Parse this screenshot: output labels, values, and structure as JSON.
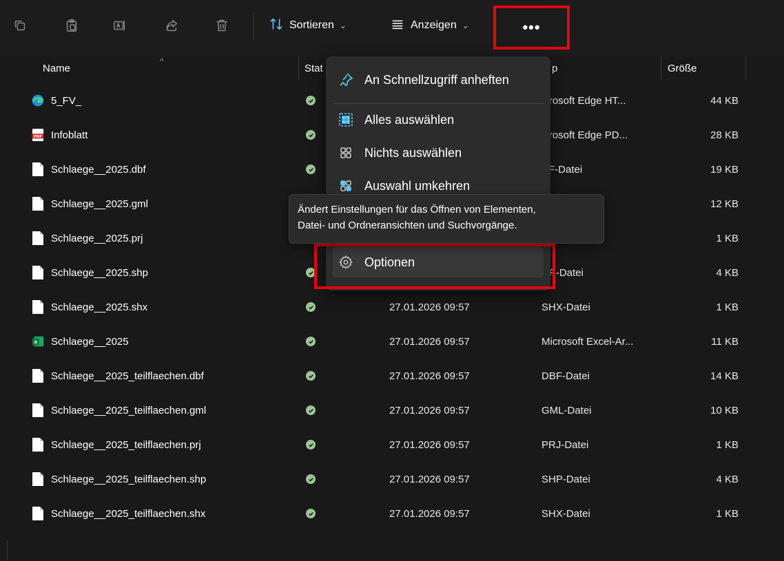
{
  "toolbar": {
    "icons": [
      "copy-icon",
      "paste-icon",
      "rename-icon",
      "share-icon",
      "delete-icon"
    ],
    "sort_label": "Sortieren",
    "view_label": "Anzeigen",
    "more_label": "•••"
  },
  "columns": {
    "name": "Name",
    "status": "Stat",
    "type": "p",
    "size": "Größe"
  },
  "menu": {
    "pin_label": "An Schnellzugriff anheften",
    "select_all_label": "Alles auswählen",
    "select_none_label": "Nichts auswählen",
    "invert_label": "Auswahl umkehren",
    "options_label": "Optionen"
  },
  "tooltip": {
    "line1": "Ändert Einstellungen für das Öffnen von Elementen,",
    "line2": "Datei- und Ordneransichten und Suchvorgänge."
  },
  "files": [
    {
      "name": "5_FV_",
      "icon": "edge-icon",
      "date": "",
      "type": "icrosoft Edge HT...",
      "size": "44 KB"
    },
    {
      "name": "Infoblatt",
      "icon": "pdf-icon",
      "date": "",
      "type": "icrosoft Edge PD...",
      "size": "28 KB"
    },
    {
      "name": "Schlaege__2025.dbf",
      "icon": "file-icon",
      "date": "",
      "type": "BF-Datei",
      "size": "19 KB"
    },
    {
      "name": "Schlaege__2025.gml",
      "icon": "file-icon",
      "date": "",
      "type": "",
      "size": "12 KB"
    },
    {
      "name": "Schlaege__2025.prj",
      "icon": "file-icon",
      "date": "",
      "type": "",
      "size": "1 KB"
    },
    {
      "name": "Schlaege__2025.shp",
      "icon": "file-icon",
      "date": "",
      "type": "HP-Datei",
      "size": "4 KB"
    },
    {
      "name": "Schlaege__2025.shx",
      "icon": "file-icon",
      "date": "27.01.2026 09:57",
      "type": "SHX-Datei",
      "size": "1 KB"
    },
    {
      "name": "Schlaege__2025",
      "icon": "excel-icon",
      "date": "27.01.2026 09:57",
      "type": "Microsoft Excel-Ar...",
      "size": "11 KB"
    },
    {
      "name": "Schlaege__2025_teilflaechen.dbf",
      "icon": "file-icon",
      "date": "27.01.2026 09:57",
      "type": "DBF-Datei",
      "size": "14 KB"
    },
    {
      "name": "Schlaege__2025_teilflaechen.gml",
      "icon": "file-icon",
      "date": "27.01.2026 09:57",
      "type": "GML-Datei",
      "size": "10 KB"
    },
    {
      "name": "Schlaege__2025_teilflaechen.prj",
      "icon": "file-icon",
      "date": "27.01.2026 09:57",
      "type": "PRJ-Datei",
      "size": "1 KB"
    },
    {
      "name": "Schlaege__2025_teilflaechen.shp",
      "icon": "file-icon",
      "date": "27.01.2026 09:57",
      "type": "SHP-Datei",
      "size": "4 KB"
    },
    {
      "name": "Schlaege__2025_teilflaechen.shx",
      "icon": "file-icon",
      "date": "27.01.2026 09:57",
      "type": "SHX-Datei",
      "size": "1 KB"
    }
  ],
  "colors": {
    "highlight_red": "#e30613",
    "status_green": "#9cc596",
    "accent_blue": "#60cdff"
  }
}
